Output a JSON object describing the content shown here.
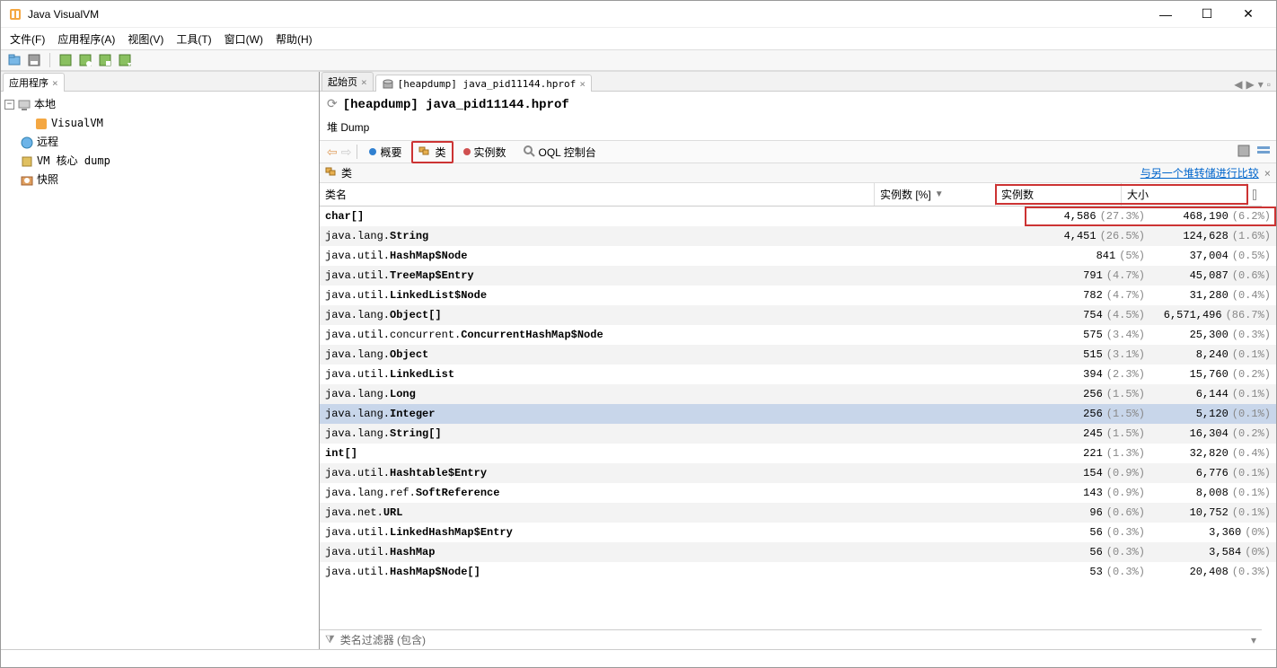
{
  "window": {
    "title": "Java VisualVM"
  },
  "menu": {
    "file": "文件(F)",
    "apps": "应用程序(A)",
    "view": "视图(V)",
    "tools": "工具(T)",
    "window": "窗口(W)",
    "help": "帮助(H)"
  },
  "sidebar": {
    "tab": "应用程序",
    "nodes": {
      "local": "本地",
      "visualvm": "VisualVM",
      "remote": "远程",
      "vmcore": "VM 核心 dump",
      "snapshots": "快照"
    }
  },
  "tabs": {
    "start": "起始页",
    "heapdump": "[heapdump] java_pid11144.hprof"
  },
  "page": {
    "title": "[heapdump] java_pid11144.hprof",
    "dumpLabel": "堆 Dump"
  },
  "views": {
    "summary": "概要",
    "classes": "类",
    "instances": "实例数",
    "oql": "OQL 控制台"
  },
  "subheader": {
    "classes": "类",
    "compareLink": "与另一个堆转储进行比较"
  },
  "columns": {
    "className": "类名",
    "instPct": "实例数 [%]",
    "instCnt": "实例数",
    "size": "大小"
  },
  "filter": {
    "label": "类名过滤器 (包含)"
  },
  "rows": [
    {
      "name_prefix": "",
      "name_bold": "char[]",
      "inst": "4,586",
      "inst_pct": "(27.3%)",
      "size": "468,190",
      "size_pct": "(6.2%)",
      "bar": 100,
      "hl": true
    },
    {
      "name_prefix": "java.lang.",
      "name_bold": "String",
      "inst": "4,451",
      "inst_pct": "(26.5%)",
      "size": "124,628",
      "size_pct": "(1.6%)",
      "bar": 40
    },
    {
      "name_prefix": "java.util.",
      "name_bold": "HashMap$Node",
      "inst": "841",
      "inst_pct": "(5%)",
      "size": "37,004",
      "size_pct": "(0.5%)",
      "bar": 6
    },
    {
      "name_prefix": "java.util.",
      "name_bold": "TreeMap$Entry",
      "inst": "791",
      "inst_pct": "(4.7%)",
      "size": "45,087",
      "size_pct": "(0.6%)",
      "bar": 5
    },
    {
      "name_prefix": "java.util.",
      "name_bold": "LinkedList$Node",
      "inst": "782",
      "inst_pct": "(4.7%)",
      "size": "31,280",
      "size_pct": "(0.4%)",
      "bar": 5
    },
    {
      "name_prefix": "java.lang.",
      "name_bold": "Object[]",
      "inst": "754",
      "inst_pct": "(4.5%)",
      "size": "6,571,496",
      "size_pct": "(86.7%)",
      "bar": 5
    },
    {
      "name_prefix": "java.util.concurrent.",
      "name_bold": "ConcurrentHashMap$Node",
      "inst": "575",
      "inst_pct": "(3.4%)",
      "size": "25,300",
      "size_pct": "(0.3%)",
      "bar": 4
    },
    {
      "name_prefix": "java.lang.",
      "name_bold": "Object",
      "inst": "515",
      "inst_pct": "(3.1%)",
      "size": "8,240",
      "size_pct": "(0.1%)",
      "bar": 4
    },
    {
      "name_prefix": "java.util.",
      "name_bold": "LinkedList",
      "inst": "394",
      "inst_pct": "(2.3%)",
      "size": "15,760",
      "size_pct": "(0.2%)",
      "bar": 3
    },
    {
      "name_prefix": "java.lang.",
      "name_bold": "Long",
      "inst": "256",
      "inst_pct": "(1.5%)",
      "size": "6,144",
      "size_pct": "(0.1%)",
      "bar": 3
    },
    {
      "name_prefix": "java.lang.",
      "name_bold": "Integer",
      "inst": "256",
      "inst_pct": "(1.5%)",
      "size": "5,120",
      "size_pct": "(0.1%)",
      "bar": 2,
      "selected": true
    },
    {
      "name_prefix": "java.lang.",
      "name_bold": "String[]",
      "inst": "245",
      "inst_pct": "(1.5%)",
      "size": "16,304",
      "size_pct": "(0.2%)",
      "bar": 2
    },
    {
      "name_prefix": "",
      "name_bold": "int[]",
      "inst": "221",
      "inst_pct": "(1.3%)",
      "size": "32,820",
      "size_pct": "(0.4%)",
      "bar": 2
    },
    {
      "name_prefix": "java.util.",
      "name_bold": "Hashtable$Entry",
      "inst": "154",
      "inst_pct": "(0.9%)",
      "size": "6,776",
      "size_pct": "(0.1%)",
      "bar": 2
    },
    {
      "name_prefix": "java.lang.ref.",
      "name_bold": "SoftReference",
      "inst": "143",
      "inst_pct": "(0.9%)",
      "size": "8,008",
      "size_pct": "(0.1%)",
      "bar": 2
    },
    {
      "name_prefix": "java.net.",
      "name_bold": "URL",
      "inst": "96",
      "inst_pct": "(0.6%)",
      "size": "10,752",
      "size_pct": "(0.1%)",
      "bar": 2
    },
    {
      "name_prefix": "java.util.",
      "name_bold": "LinkedHashMap$Entry",
      "inst": "56",
      "inst_pct": "(0.3%)",
      "size": "3,360",
      "size_pct": "(0%)",
      "bar": 1
    },
    {
      "name_prefix": "java.util.",
      "name_bold": "HashMap",
      "inst": "56",
      "inst_pct": "(0.3%)",
      "size": "3,584",
      "size_pct": "(0%)",
      "bar": 1
    },
    {
      "name_prefix": "java.util.",
      "name_bold": "HashMap$Node[]",
      "inst": "53",
      "inst_pct": "(0.3%)",
      "size": "20,408",
      "size_pct": "(0.3%)",
      "bar": 1
    }
  ]
}
